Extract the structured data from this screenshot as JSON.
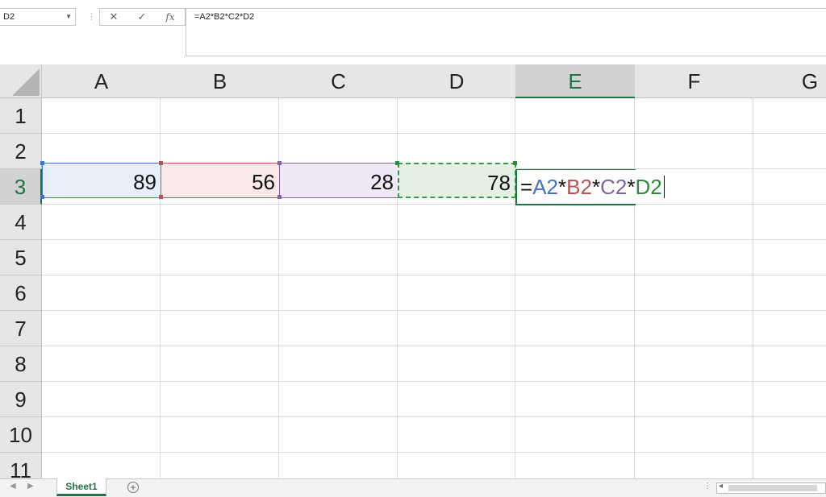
{
  "formula_bar": {
    "name_box": "D2",
    "cancel_icon": "✕",
    "enter_icon": "✓",
    "fx_label": "fx",
    "formula": "=A2*B2*C2*D2"
  },
  "columns": [
    "A",
    "B",
    "C",
    "D",
    "E",
    "F",
    "G"
  ],
  "rows": [
    "1",
    "2",
    "3",
    "4",
    "5",
    "6",
    "7",
    "8",
    "9",
    "10",
    "11"
  ],
  "cells": {
    "A2": "89",
    "B2": "56",
    "C2": "28",
    "D2": "78"
  },
  "editing": {
    "cell": "E3",
    "parts": [
      "=",
      "A2",
      "*",
      "B2",
      "*",
      "C2",
      "*",
      "D2"
    ],
    "ref_colors": {
      "A2": "#4472c4",
      "B2": "#c0504d",
      "C2": "#8064a2",
      "D2": "#2e8b3e"
    }
  },
  "sheet_bar": {
    "tab_label": "Sheet1",
    "add_sheet_icon": "+"
  },
  "icons": {
    "name_box_dropdown": "chevron-down-icon",
    "cancel": "close-icon",
    "enter": "check-icon",
    "insert_function": "fx-icon",
    "add_sheet": "plus-circle-icon",
    "scroll_left": "chevron-left-icon"
  }
}
